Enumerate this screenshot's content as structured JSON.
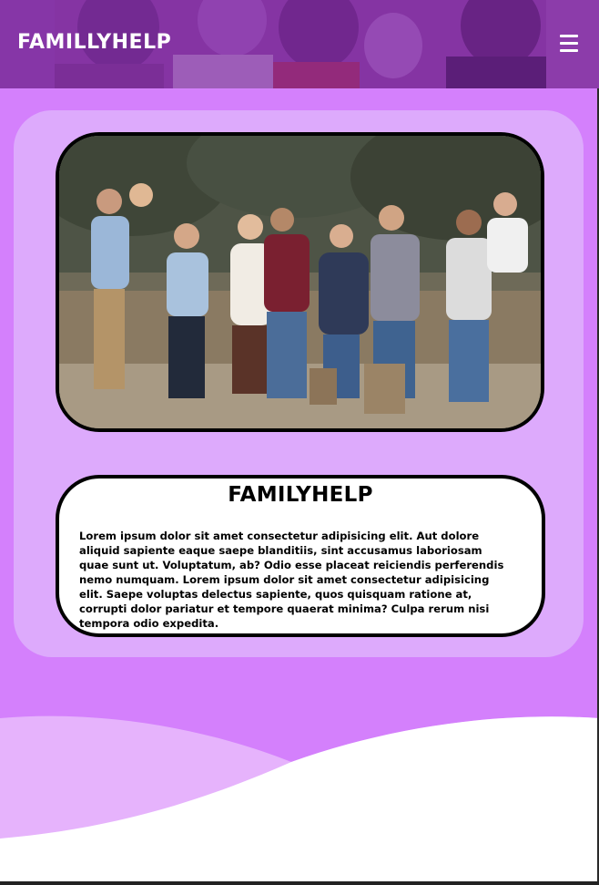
{
  "header": {
    "brand": "FAMILLYHELP",
    "menu_icon": "hamburger-menu-icon"
  },
  "hero": {
    "image": "family-group-photo"
  },
  "about": {
    "title": "FAMILYHELP",
    "body": "Lorem ipsum dolor sit amet consectetur adipisicing elit. Aut dolore aliquid sapiente eaque saepe blanditiis, sint accusamus laboriosam quae sunt ut. Voluptatum, ab? Odio esse placeat reiciendis perferendis nemo numquam. Lorem ipsum dolor sit amet consectetur adipisicing elit. Saepe voluptas delectus sapiente, quos quisquam ratione at, corrupti dolor pariatur et tempore quaerat minima? Culpa rerum nisi tempora odio expedita."
  },
  "colors": {
    "header_overlay": "#7a2a9a",
    "main_bg": "#d480fc",
    "card_bg": "#ddaafc",
    "wave_light": "#e6b3fc",
    "text": "#000000"
  }
}
